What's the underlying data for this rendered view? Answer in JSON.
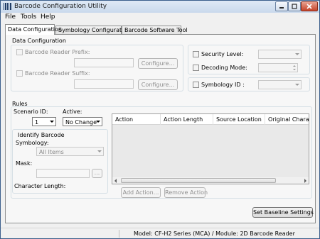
{
  "window": {
    "title": "Barcode Configuration Utility"
  },
  "menu": [
    "File",
    "Tools",
    "Help"
  ],
  "tabs": [
    "Data Configuration",
    "Symbology Configuration",
    "Barcode Software Tool"
  ],
  "data_config": {
    "group_title": "Data Configuration",
    "prefix_label": "Barcode Reader Prefix:",
    "suffix_label": "Barcode Reader Suffix:",
    "configure_label": "Configure...",
    "security_level_label": "Security Level:",
    "decoding_mode_label": "Decoding Mode:",
    "symbology_id_label": "Symbology ID :"
  },
  "rules": {
    "group_title": "Rules",
    "scenario_label": "Scenario ID:",
    "scenario_value": "1",
    "active_label": "Active:",
    "active_value": "No Change",
    "identify_title": "Identify Barcode",
    "symbology_label": "Symbology:",
    "symbology_value": "All Items",
    "mask_label": "Mask:",
    "browse_label": "...",
    "char_length_label": "Character Length:",
    "columns": [
      "Action",
      "Action Length",
      "Source Location",
      "Original Characte"
    ],
    "add_action_label": "Add Action...",
    "remove_action_label": "Remove Action"
  },
  "set_baseline_label": "Set Baseline Settings",
  "status": {
    "model": "Model: CF-H2 Series (MCA) / Module: 2D Barcode Reader"
  },
  "colors": {
    "title_bar": "#c9d9ec",
    "close_button": "#c6442a",
    "panel": "#f7f7f7"
  },
  "icons": [
    "barcode-app-icon",
    "minimize-icon",
    "maximize-icon",
    "close-icon",
    "chevron-down-icon"
  ]
}
